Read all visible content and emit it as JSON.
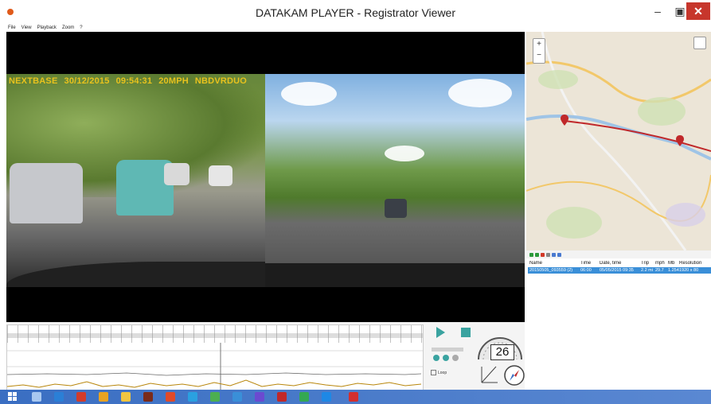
{
  "window": {
    "title": "DATAKAM PLAYER - Registrator Viewer"
  },
  "menu": [
    "File",
    "View",
    "Playback",
    "Zoom",
    "?"
  ],
  "overlay": {
    "brand": "NEXTBASE",
    "date": "30/12/2015",
    "time": "09:54:31",
    "speed": "20MPH",
    "model": "NBDVRDUO"
  },
  "list": {
    "columns": [
      "Name",
      "Time",
      "Date, time",
      "Trip",
      "mph",
      "Mb",
      "Resolution"
    ],
    "rows": [
      [
        "20150505_093559 (2)",
        "06:00",
        "05/05/2015 09:35",
        "2.2 mi",
        "29.7",
        "1.254",
        "1920 x 80"
      ]
    ]
  },
  "speed_display": "26",
  "map": {
    "zoom_in": "+",
    "zoom_out": "−"
  },
  "colors": {
    "accent": "#3aa3a0",
    "overlay": "#e8c21d",
    "selection": "#3a8fd8",
    "close": "#c7362c",
    "route": "#c0282a"
  },
  "icons": [
    "app-icon",
    "minimize-icon",
    "maximize-icon",
    "close-icon",
    "play-icon",
    "stop-icon",
    "speedometer-icon",
    "compass-icon",
    "axis-icon",
    "map-pin-icon",
    "windows-start-icon"
  ]
}
